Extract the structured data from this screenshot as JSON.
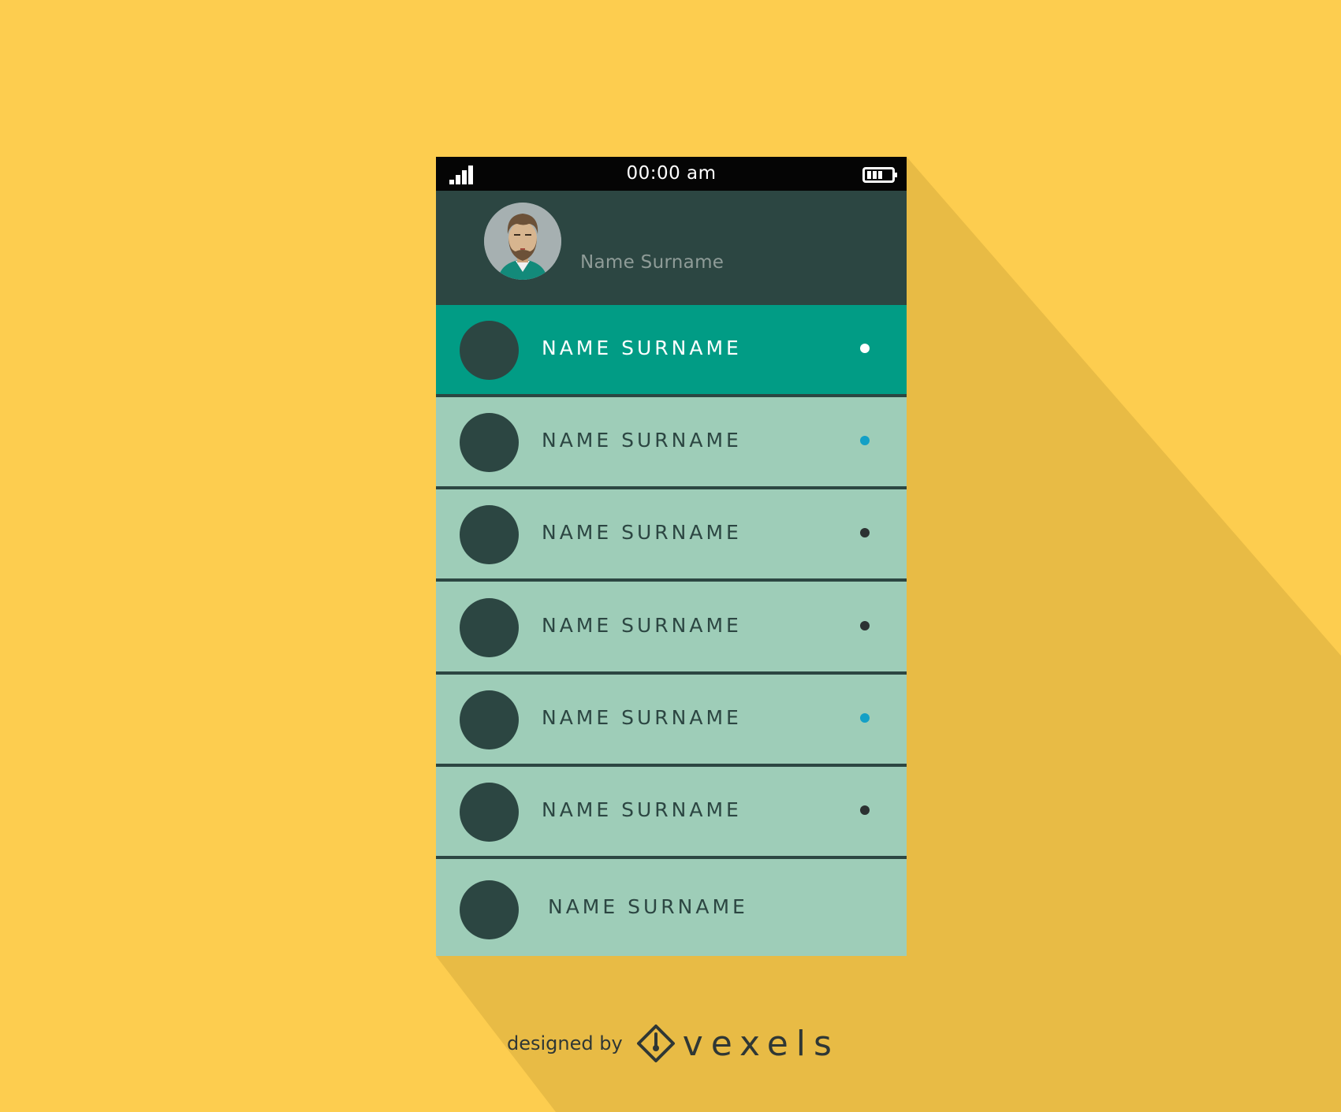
{
  "status_bar": {
    "time": "00:00 am",
    "signal_icon": "signal-bars-icon",
    "battery_icon": "battery-icon"
  },
  "profile": {
    "name": "Name Surname",
    "avatar_icon": "bearded-man-avatar"
  },
  "contacts": [
    {
      "name": "NAME SURNAME",
      "status": "white",
      "active": true
    },
    {
      "name": "NAME SURNAME",
      "status": "blue"
    },
    {
      "name": "NAME SURNAME",
      "status": "dark"
    },
    {
      "name": "NAME SURNAME",
      "status": "dark"
    },
    {
      "name": "NAME SURNAME",
      "status": "blue"
    },
    {
      "name": "NAME SURNAME",
      "status": "dark"
    },
    {
      "name": "NAME SURNAME",
      "status": "none"
    }
  ],
  "watermark": {
    "prefix": "designed by",
    "brand": "vexels",
    "logo_icon": "vexels-diamond-logo"
  },
  "colors": {
    "background": "#fdcd4f",
    "shadow": "#e8bb45",
    "header": "#2c4642",
    "active_row": "#019c85",
    "row": "#9ecdb8",
    "dot_blue": "#14a0c6",
    "dot_dark": "#2c3232",
    "dot_white": "#ffffff"
  }
}
